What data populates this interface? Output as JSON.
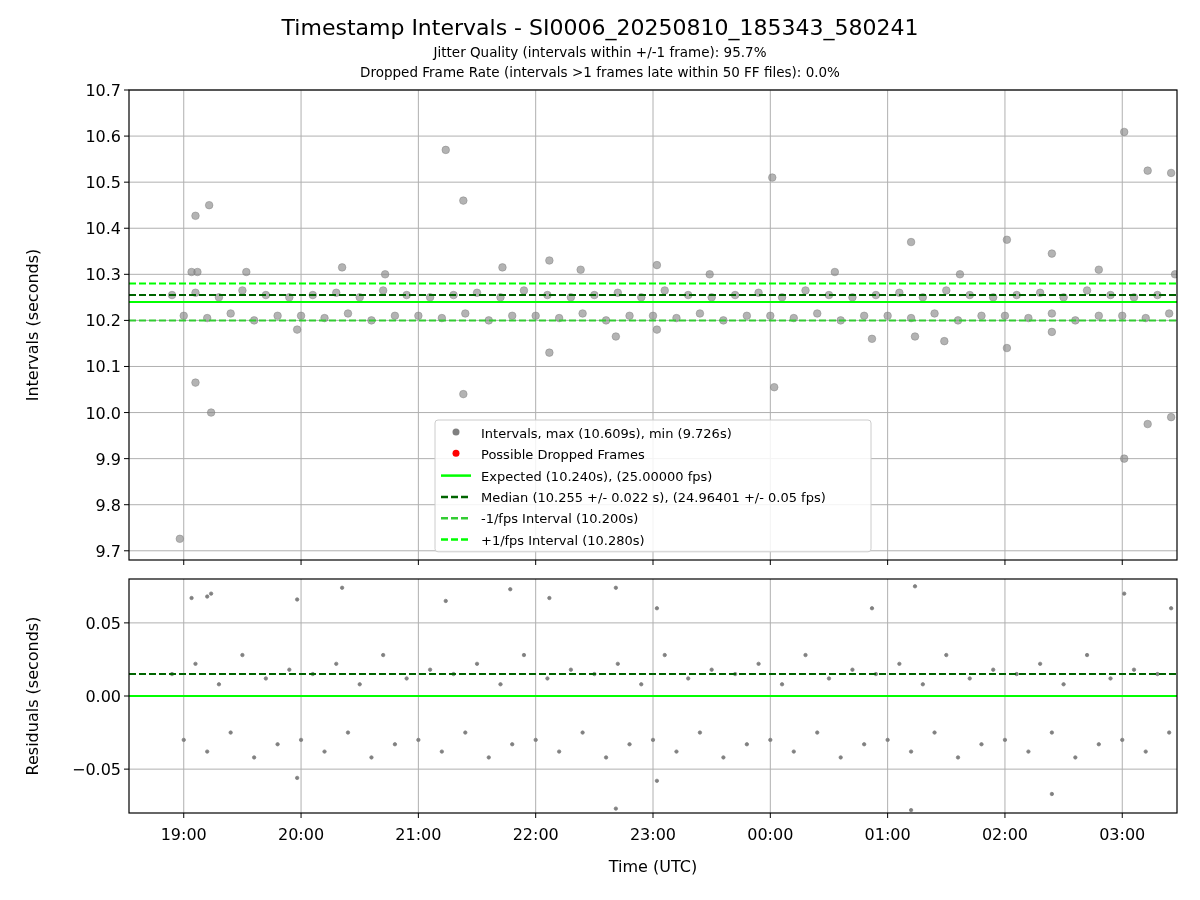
{
  "figure": {
    "title": "Timestamp Intervals - SI0006_20250810_185343_580241",
    "subtitles": [
      "Jitter Quality (intervals within +/-1 frame): 95.7%",
      "Dropped Frame Rate (intervals >1 frames late within 50 FF files): 0.0%"
    ]
  },
  "top_panel": {
    "chart_data": {
      "type": "scatter",
      "grid": true,
      "legend": "lower center",
      "ylabel": "Intervals (seconds)",
      "xlim": [
        "2025-08-10T18:32",
        "2025-08-11T03:28"
      ],
      "ylim": [
        9.68,
        10.7
      ],
      "yticks": [
        {
          "value": 9.7,
          "label": "9.7"
        },
        {
          "value": 9.8,
          "label": "9.8"
        },
        {
          "value": 9.9,
          "label": "9.9"
        },
        {
          "value": 10.0,
          "label": "10.0"
        },
        {
          "value": 10.1,
          "label": "10.1"
        },
        {
          "value": 10.2,
          "label": "10.2"
        },
        {
          "value": 10.3,
          "label": "10.3"
        },
        {
          "value": 10.4,
          "label": "10.4"
        },
        {
          "value": 10.5,
          "label": "10.5"
        },
        {
          "value": 10.6,
          "label": "10.6"
        },
        {
          "value": 10.7,
          "label": "10.7"
        }
      ],
      "series": [
        {
          "name": "Intervals, max (10.609s), min (9.726s)",
          "color": "#808080",
          "x": [
            "2025-08-10T18:54",
            "2025-08-10T19:06",
            "2025-08-10T19:18",
            "2025-08-10T19:30",
            "2025-08-10T19:42",
            "2025-08-10T19:54",
            "2025-08-10T20:06",
            "2025-08-10T20:18",
            "2025-08-10T20:30",
            "2025-08-10T20:42",
            "2025-08-10T20:54",
            "2025-08-10T21:06",
            "2025-08-10T21:18",
            "2025-08-10T21:30",
            "2025-08-10T21:42",
            "2025-08-10T21:54",
            "2025-08-10T22:06",
            "2025-08-10T22:18",
            "2025-08-10T22:30",
            "2025-08-10T22:42",
            "2025-08-10T22:54",
            "2025-08-10T23:06",
            "2025-08-10T23:18",
            "2025-08-10T23:30",
            "2025-08-10T23:42",
            "2025-08-10T23:54",
            "2025-08-11T00:06",
            "2025-08-11T00:18",
            "2025-08-11T00:30",
            "2025-08-11T00:42",
            "2025-08-11T00:54",
            "2025-08-11T01:06",
            "2025-08-11T01:18",
            "2025-08-11T01:30",
            "2025-08-11T01:42",
            "2025-08-11T01:54",
            "2025-08-11T02:06",
            "2025-08-11T02:18",
            "2025-08-11T02:30",
            "2025-08-11T02:42",
            "2025-08-11T02:54",
            "2025-08-11T03:06",
            "2025-08-11T03:18",
            "2025-08-10T19:00",
            "2025-08-10T19:12",
            "2025-08-10T19:24",
            "2025-08-10T19:36",
            "2025-08-10T19:48",
            "2025-08-10T20:00",
            "2025-08-10T20:12",
            "2025-08-10T20:24",
            "2025-08-10T20:36",
            "2025-08-10T20:48",
            "2025-08-10T21:00",
            "2025-08-10T21:12",
            "2025-08-10T21:24",
            "2025-08-10T21:36",
            "2025-08-10T21:48",
            "2025-08-10T22:00",
            "2025-08-10T22:12",
            "2025-08-10T22:24",
            "2025-08-10T22:36",
            "2025-08-10T22:48",
            "2025-08-10T23:00",
            "2025-08-10T23:12",
            "2025-08-10T23:24",
            "2025-08-10T23:36",
            "2025-08-10T23:48",
            "2025-08-11T00:00",
            "2025-08-11T00:12",
            "2025-08-11T00:24",
            "2025-08-11T00:36",
            "2025-08-11T00:48",
            "2025-08-11T01:00",
            "2025-08-11T01:12",
            "2025-08-11T01:24",
            "2025-08-11T01:36",
            "2025-08-11T01:48",
            "2025-08-11T02:00",
            "2025-08-11T02:12",
            "2025-08-11T02:24",
            "2025-08-11T02:36",
            "2025-08-11T02:48",
            "2025-08-11T03:00",
            "2025-08-11T03:12",
            "2025-08-11T03:24",
            "2025-08-10T18:58",
            "2025-08-10T19:04",
            "2025-08-10T19:06",
            "2025-08-10T19:07",
            "2025-08-10T19:06",
            "2025-08-10T19:13",
            "2025-08-10T19:14",
            "2025-08-10T19:58",
            "2025-08-10T20:21",
            "2025-08-10T21:14",
            "2025-08-10T21:23",
            "2025-08-10T21:23",
            "2025-08-10T22:07",
            "2025-08-10T22:07",
            "2025-08-10T22:41",
            "2025-08-10T23:02",
            "2025-08-10T23:02",
            "2025-08-11T00:01",
            "2025-08-11T00:02",
            "2025-08-11T00:52",
            "2025-08-11T01:12",
            "2025-08-11T01:14",
            "2025-08-11T01:29",
            "2025-08-11T02:01",
            "2025-08-11T02:01",
            "2025-08-11T02:24",
            "2025-08-11T02:24",
            "2025-08-11T03:01",
            "2025-08-11T03:01",
            "2025-08-11T03:13",
            "2025-08-11T03:13",
            "2025-08-11T03:25",
            "2025-08-11T03:25",
            "2025-08-11T03:27",
            "2025-08-10T19:32",
            "2025-08-10T20:43",
            "2025-08-10T21:43",
            "2025-08-10T22:23",
            "2025-08-10T23:29",
            "2025-08-11T00:33",
            "2025-08-11T01:37",
            "2025-08-11T02:48"
          ],
          "values": [
            10.255,
            10.26,
            10.25,
            10.265,
            10.255,
            10.25,
            10.255,
            10.26,
            10.25,
            10.265,
            10.255,
            10.25,
            10.255,
            10.26,
            10.25,
            10.265,
            10.255,
            10.25,
            10.255,
            10.26,
            10.25,
            10.265,
            10.255,
            10.25,
            10.255,
            10.26,
            10.25,
            10.265,
            10.255,
            10.25,
            10.255,
            10.26,
            10.25,
            10.265,
            10.255,
            10.25,
            10.255,
            10.26,
            10.25,
            10.265,
            10.255,
            10.25,
            10.255,
            10.21,
            10.205,
            10.215,
            10.2,
            10.21,
            10.21,
            10.205,
            10.215,
            10.2,
            10.21,
            10.21,
            10.205,
            10.215,
            10.2,
            10.21,
            10.21,
            10.205,
            10.215,
            10.2,
            10.21,
            10.21,
            10.205,
            10.215,
            10.2,
            10.21,
            10.21,
            10.205,
            10.215,
            10.2,
            10.21,
            10.21,
            10.205,
            10.215,
            10.2,
            10.21,
            10.21,
            10.205,
            10.215,
            10.2,
            10.21,
            10.21,
            10.205,
            10.215,
            9.726,
            10.305,
            10.427,
            10.305,
            10.065,
            10.45,
            10.0,
            10.18,
            10.315,
            10.57,
            10.46,
            10.04,
            10.13,
            10.33,
            10.165,
            10.32,
            10.18,
            10.51,
            10.055,
            10.16,
            10.37,
            10.165,
            10.155,
            10.375,
            10.14,
            10.175,
            10.345,
            10.609,
            9.9,
            10.525,
            9.975,
            10.52,
            9.99,
            10.3,
            10.305,
            10.3,
            10.315,
            10.31,
            10.3,
            10.305,
            10.3,
            10.31
          ]
        },
        {
          "name": "Possible Dropped Frames",
          "color": "#ff0000"
        },
        {
          "name": "Expected (10.240s), (25.00000 fps)",
          "type": "line",
          "line_style": "solid",
          "color": "#00ff00",
          "x": [
            "2025-08-10T18:32",
            "2025-08-11T03:28"
          ],
          "values": [
            10.24,
            10.24
          ]
        },
        {
          "name": "Median (10.255 +/- 0.022 s), (24.96401 +/- 0.05 fps)",
          "type": "line",
          "line_style": "dashed",
          "color": "#006400",
          "x": [
            "2025-08-10T18:32",
            "2025-08-11T03:28"
          ],
          "values": [
            10.255,
            10.255
          ]
        },
        {
          "name": "-1/fps Interval (10.200s)",
          "type": "line",
          "line_style": "dashed",
          "color": "#32cd32",
          "x": [
            "2025-08-10T18:32",
            "2025-08-11T03:28"
          ],
          "values": [
            10.2,
            10.2
          ]
        },
        {
          "name": "+1/fps Interval (10.280s)",
          "type": "line",
          "line_style": "dashed",
          "color": "#00ff00",
          "x": [
            "2025-08-10T18:32",
            "2025-08-11T03:28"
          ],
          "values": [
            10.28,
            10.28
          ]
        }
      ]
    }
  },
  "bottom_panel": {
    "chart_data": {
      "type": "scatter",
      "grid": true,
      "xlabel": "Time (UTC)",
      "ylabel": "Residuals (seconds)",
      "xlim": [
        "2025-08-10T18:32",
        "2025-08-11T03:28"
      ],
      "ylim": [
        -0.08,
        0.08
      ],
      "xticks": [
        {
          "value": "2025-08-10T19:00",
          "label": "19:00"
        },
        {
          "value": "2025-08-10T20:00",
          "label": "20:00"
        },
        {
          "value": "2025-08-10T21:00",
          "label": "21:00"
        },
        {
          "value": "2025-08-10T22:00",
          "label": "22:00"
        },
        {
          "value": "2025-08-10T23:00",
          "label": "23:00"
        },
        {
          "value": "2025-08-11T00:00",
          "label": "00:00"
        },
        {
          "value": "2025-08-11T01:00",
          "label": "01:00"
        },
        {
          "value": "2025-08-11T02:00",
          "label": "02:00"
        },
        {
          "value": "2025-08-11T03:00",
          "label": "03:00"
        }
      ],
      "yticks": [
        {
          "value": -0.05,
          "label": "−0.05"
        },
        {
          "value": 0,
          "label": "0.00"
        },
        {
          "value": 0.05,
          "label": "0.05"
        }
      ],
      "series": [
        {
          "color": "#808080",
          "x": [
            "2025-08-10T18:54",
            "2025-08-10T19:06",
            "2025-08-10T19:18",
            "2025-08-10T19:30",
            "2025-08-10T19:42",
            "2025-08-10T19:54",
            "2025-08-10T20:06",
            "2025-08-10T20:18",
            "2025-08-10T20:30",
            "2025-08-10T20:42",
            "2025-08-10T20:54",
            "2025-08-10T21:06",
            "2025-08-10T21:18",
            "2025-08-10T21:30",
            "2025-08-10T21:42",
            "2025-08-10T21:54",
            "2025-08-10T22:06",
            "2025-08-10T22:18",
            "2025-08-10T22:30",
            "2025-08-10T22:42",
            "2025-08-10T22:54",
            "2025-08-10T23:06",
            "2025-08-10T23:18",
            "2025-08-10T23:30",
            "2025-08-10T23:42",
            "2025-08-10T23:54",
            "2025-08-11T00:06",
            "2025-08-11T00:18",
            "2025-08-11T00:30",
            "2025-08-11T00:42",
            "2025-08-11T00:54",
            "2025-08-11T01:06",
            "2025-08-11T01:18",
            "2025-08-11T01:30",
            "2025-08-11T01:42",
            "2025-08-11T01:54",
            "2025-08-11T02:06",
            "2025-08-11T02:18",
            "2025-08-11T02:30",
            "2025-08-11T02:42",
            "2025-08-11T02:54",
            "2025-08-11T03:06",
            "2025-08-11T03:18",
            "2025-08-10T19:00",
            "2025-08-10T19:12",
            "2025-08-10T19:24",
            "2025-08-10T19:36",
            "2025-08-10T19:48",
            "2025-08-10T20:00",
            "2025-08-10T20:12",
            "2025-08-10T20:24",
            "2025-08-10T20:36",
            "2025-08-10T20:48",
            "2025-08-10T21:00",
            "2025-08-10T21:12",
            "2025-08-10T21:24",
            "2025-08-10T21:36",
            "2025-08-10T21:48",
            "2025-08-10T22:00",
            "2025-08-10T22:12",
            "2025-08-10T22:24",
            "2025-08-10T22:36",
            "2025-08-10T22:48",
            "2025-08-10T23:00",
            "2025-08-10T23:12",
            "2025-08-10T23:24",
            "2025-08-10T23:36",
            "2025-08-10T23:48",
            "2025-08-11T00:00",
            "2025-08-11T00:12",
            "2025-08-11T00:24",
            "2025-08-11T00:36",
            "2025-08-11T00:48",
            "2025-08-11T01:00",
            "2025-08-11T01:12",
            "2025-08-11T01:24",
            "2025-08-11T01:36",
            "2025-08-11T01:48",
            "2025-08-11T02:00",
            "2025-08-11T02:12",
            "2025-08-11T02:24",
            "2025-08-11T02:36",
            "2025-08-11T02:48",
            "2025-08-11T03:00",
            "2025-08-11T03:12",
            "2025-08-11T03:24",
            "2025-08-10T19:04",
            "2025-08-10T19:12",
            "2025-08-10T19:14",
            "2025-08-10T19:58",
            "2025-08-10T20:21",
            "2025-08-10T21:14",
            "2025-08-10T21:47",
            "2025-08-10T22:07",
            "2025-08-10T22:41",
            "2025-08-10T23:02",
            "2025-08-11T00:52",
            "2025-08-11T01:14",
            "2025-08-11T03:01",
            "2025-08-11T03:25",
            "2025-08-10T19:58",
            "2025-08-10T23:02",
            "2025-08-10T22:41",
            "2025-08-11T01:12",
            "2025-08-11T02:24"
          ],
          "values": [
            0.015,
            0.022,
            0.008,
            0.028,
            0.012,
            0.018,
            0.015,
            0.022,
            0.008,
            0.028,
            0.012,
            0.018,
            0.015,
            0.022,
            0.008,
            0.028,
            0.012,
            0.018,
            0.015,
            0.022,
            0.008,
            0.028,
            0.012,
            0.018,
            0.015,
            0.022,
            0.008,
            0.028,
            0.012,
            0.018,
            0.015,
            0.022,
            0.008,
            0.028,
            0.012,
            0.018,
            0.015,
            0.022,
            0.008,
            0.028,
            0.012,
            0.018,
            0.015,
            -0.03,
            -0.038,
            -0.025,
            -0.042,
            -0.033,
            -0.03,
            -0.038,
            -0.025,
            -0.042,
            -0.033,
            -0.03,
            -0.038,
            -0.025,
            -0.042,
            -0.033,
            -0.03,
            -0.038,
            -0.025,
            -0.042,
            -0.033,
            -0.03,
            -0.038,
            -0.025,
            -0.042,
            -0.033,
            -0.03,
            -0.038,
            -0.025,
            -0.042,
            -0.033,
            -0.03,
            -0.038,
            -0.025,
            -0.042,
            -0.033,
            -0.03,
            -0.038,
            -0.025,
            -0.042,
            -0.033,
            -0.03,
            -0.038,
            -0.025,
            0.067,
            0.068,
            0.07,
            0.066,
            0.074,
            0.065,
            0.073,
            0.067,
            0.074,
            0.06,
            0.06,
            0.075,
            0.07,
            0.06,
            -0.056,
            -0.058,
            -0.077,
            -0.078,
            -0.067
          ]
        },
        {
          "type": "line",
          "line_style": "solid",
          "color": "#00ff00",
          "x": [
            "2025-08-10T18:32",
            "2025-08-11T03:28"
          ],
          "values": [
            0,
            0
          ]
        },
        {
          "type": "line",
          "line_style": "dashed",
          "color": "#006400",
          "x": [
            "2025-08-10T18:32",
            "2025-08-11T03:28"
          ],
          "values": [
            0.015,
            0.015
          ]
        }
      ]
    }
  }
}
